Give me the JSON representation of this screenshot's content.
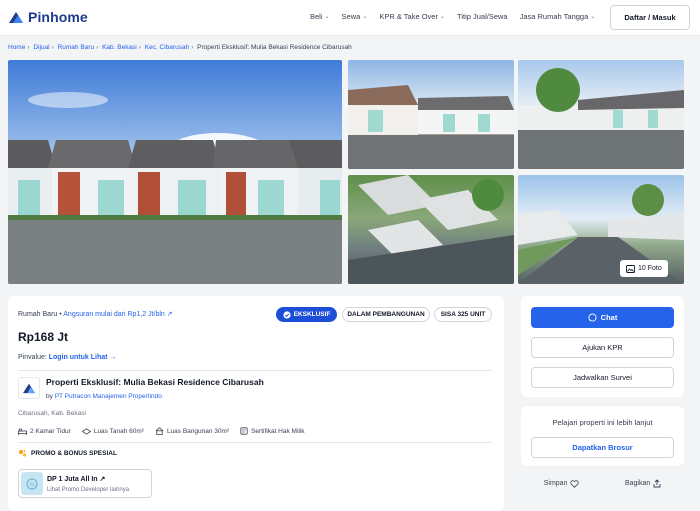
{
  "header": {
    "brand": "Pinhome",
    "nav": [
      {
        "label": "Beli"
      },
      {
        "label": "Sewa"
      },
      {
        "label": "KPR & Take Over"
      },
      {
        "label": "Titip Jual/Sewa"
      },
      {
        "label": "Jasa Rumah Tangga"
      }
    ],
    "login_label": "Daftar / Masuk"
  },
  "breadcrumb": [
    "Home",
    "Dijual",
    "Rumah Baru",
    "Kab. Bekasi",
    "Kec. Cibarusah",
    "Properti Eksklusif: Mulia Bekasi Residence Cibarusah"
  ],
  "gallery": {
    "photo_count_label": "10 Foto"
  },
  "listing": {
    "type": "Rumah Baru",
    "installment": "Angsuran mulai dari Rp1,2 Jt/bln",
    "badges": {
      "exclusive": "EKSKLUSIF",
      "status": "DALAM PEMBANGUNAN",
      "units": "SISA 325 UNIT"
    },
    "price": "Rp168 Jt",
    "pinvalue_label": "Pinvalue:",
    "pinvalue_link": "Login untuk Lihat",
    "title": "Properti Eksklusif: Mulia Bekasi Residence Cibarusah",
    "by_prefix": "by",
    "developer": "PT Putracon Manajemen Propertindo",
    "location": "Cibarusah, Kab. Bekasi",
    "specs": [
      {
        "label": "2 Kamar Tidur",
        "icon": "bed-icon"
      },
      {
        "label": "Luas Tanah 60m²",
        "icon": "land-area-icon"
      },
      {
        "label": "Luas Bangunan 30m²",
        "icon": "building-area-icon"
      },
      {
        "label": "Sertifikat Hak Milik",
        "icon": "certificate-icon"
      }
    ],
    "promo_heading": "PROMO & BONUS SPESIAL",
    "promo": {
      "title": "DP 1 Juta All In",
      "subtitle": "Lihat Promo Developer lainnya"
    }
  },
  "sidebar": {
    "chat_label": "Chat",
    "kpr_label": "Ajukan KPR",
    "survey_label": "Jadwalkan Survei",
    "learn_text": "Pelajari properti ini lebih lanjut",
    "brochure_label": "Dapatkan Brosur",
    "save_label": "Simpan",
    "share_label": "Bagikan"
  },
  "colors": {
    "primary": "#2563eb",
    "brand": "#1e3a8a",
    "badge_exclusive": "#1d4ed8"
  }
}
